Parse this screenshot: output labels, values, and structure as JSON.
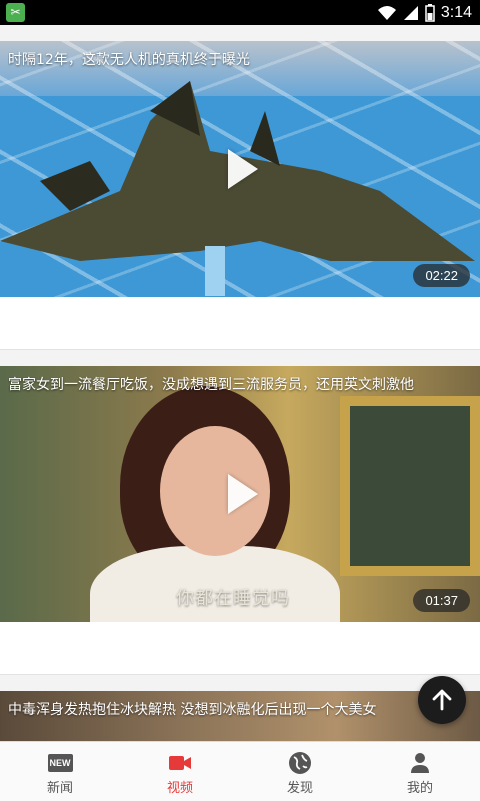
{
  "status_bar": {
    "time": "3:14",
    "app_icon": "scissors-icon"
  },
  "feed": {
    "items": [
      {
        "title": "时隔12年，这款无人机的真机终于曝光",
        "duration": "02:22"
      },
      {
        "title": "富家女到一流餐厅吃饭，没成想遇到三流服务员，还用英文刺激他",
        "duration": "01:37",
        "subtitle": "你都在睡觉吗"
      },
      {
        "title": "中毒浑身发热抱住冰块解热 没想到冰融化后出现一个大美女"
      }
    ]
  },
  "bottom_nav": {
    "items": [
      {
        "label": "新闻",
        "icon": "news-icon",
        "badge": "NEW"
      },
      {
        "label": "视频",
        "icon": "video-camera-icon",
        "active": true
      },
      {
        "label": "发现",
        "icon": "globe-icon"
      },
      {
        "label": "我的",
        "icon": "person-icon"
      }
    ]
  },
  "colors": {
    "accent": "#e63a3a",
    "fab": "#1c1c1c"
  }
}
